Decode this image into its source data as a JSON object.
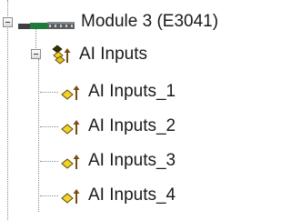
{
  "tree": {
    "module": {
      "label": "Module 3 (E3041)",
      "icon": "hardware-module-icon",
      "expanded": true
    },
    "group": {
      "label": "AI Inputs",
      "icon": "io-group-icon",
      "expanded": true,
      "children": [
        {
          "label": "AI Inputs_1",
          "icon": "analog-input-icon"
        },
        {
          "label": "AI Inputs_2",
          "icon": "analog-input-icon"
        },
        {
          "label": "AI Inputs_3",
          "icon": "analog-input-icon"
        },
        {
          "label": "AI Inputs_4",
          "icon": "analog-input-icon"
        }
      ]
    }
  }
}
